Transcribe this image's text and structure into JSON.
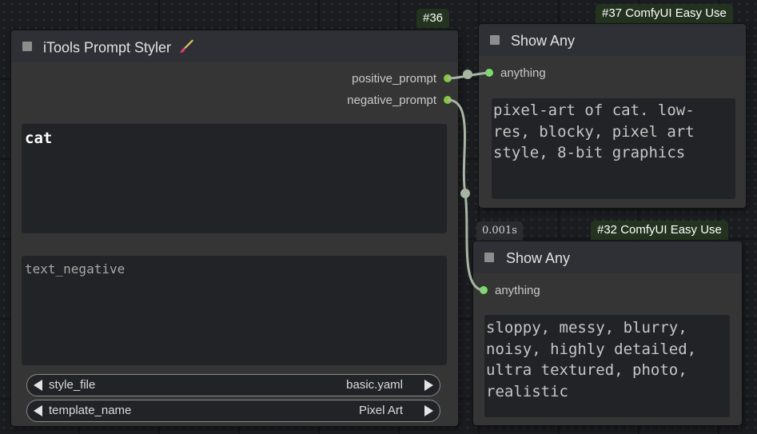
{
  "nodes": {
    "styler": {
      "id_badge": "#36",
      "title": "iTools Prompt Styler",
      "title_icon": "paintbrush-icon",
      "outputs": [
        {
          "label": "positive_prompt",
          "color": "#8bc34a"
        },
        {
          "label": "negative_prompt",
          "color": "#8bc34a"
        }
      ],
      "text_positive": {
        "value": "cat"
      },
      "text_negative": {
        "placeholder": "text_negative",
        "value": ""
      },
      "widgets": [
        {
          "label": "style_file",
          "value": "basic.yaml"
        },
        {
          "label": "template_name",
          "value": "Pixel Art"
        }
      ]
    },
    "show_any_top": {
      "badge": "#37 ComfyUI Easy Use",
      "title": "Show Any",
      "input_label": "anything",
      "text": "pixel-art of cat. low-res, blocky, pixel art style, 8-bit graphics"
    },
    "show_any_bottom": {
      "badge": "#32 ComfyUI Easy Use",
      "time": "0.001s",
      "title": "Show Any",
      "input_label": "anything",
      "text": "sloppy, messy, blurry, noisy, highly detailed, ultra textured, photo, realistic"
    }
  },
  "colors": {
    "link": "#a6b6a3",
    "slot_output": "#8bc34a",
    "slot_input": "#7ddc6e",
    "badge_bg": "#23331f"
  }
}
